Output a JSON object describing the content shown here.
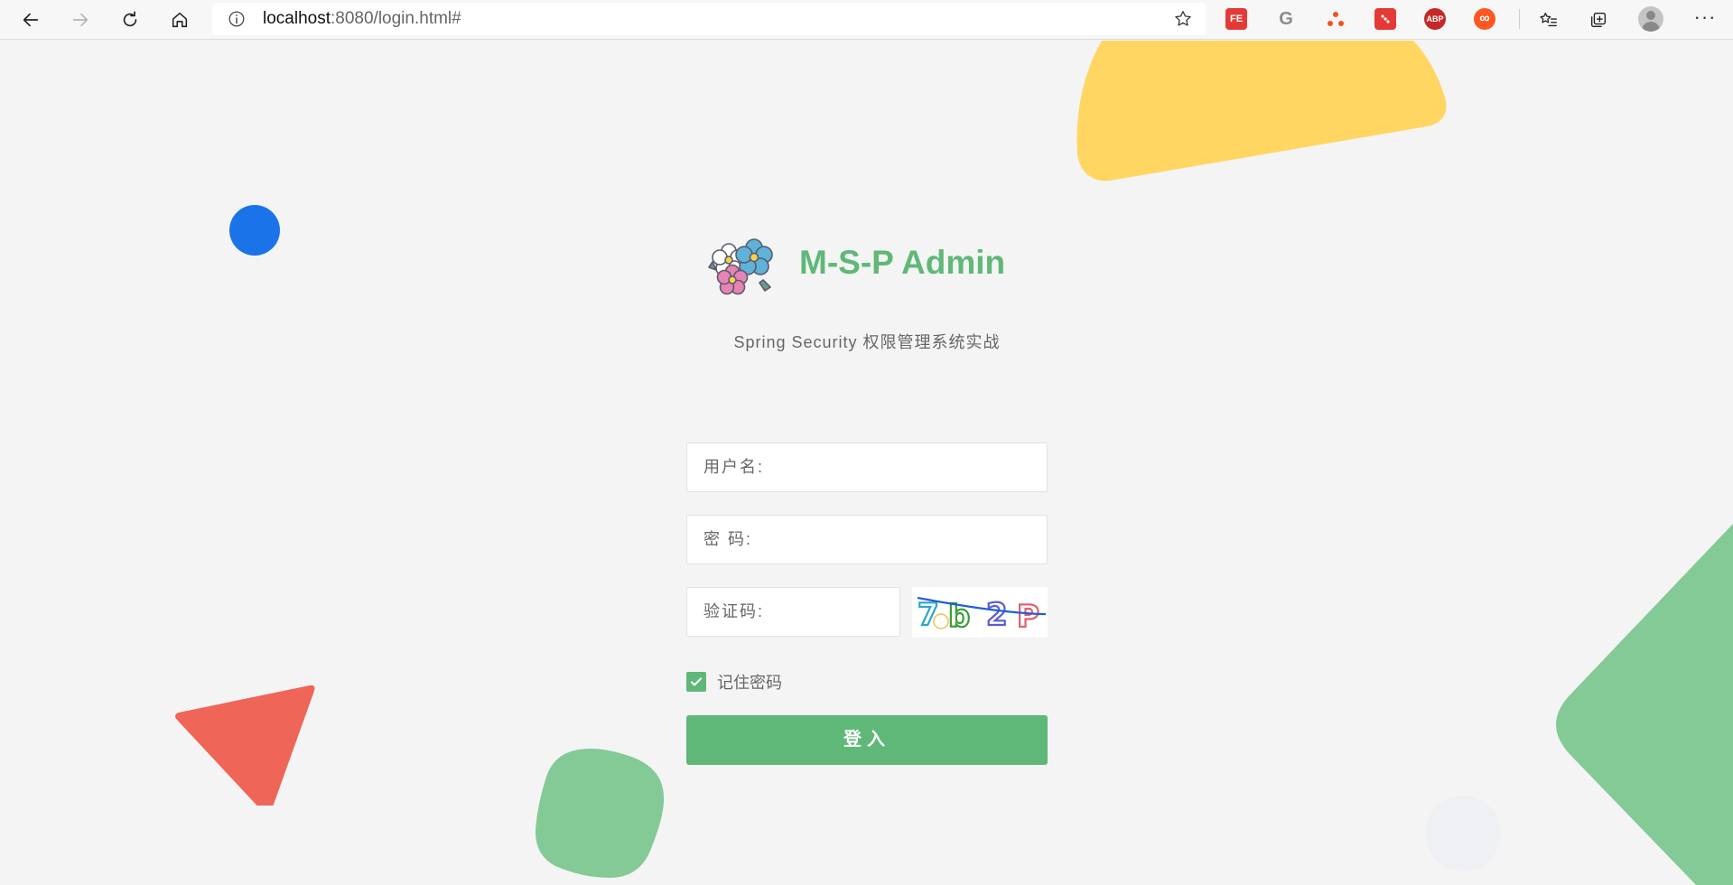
{
  "browser": {
    "address_url_host": "localhost",
    "address_url_rest": ":8080/login.html#",
    "nav": {
      "back_icon": "arrow-left-icon",
      "forward_icon": "arrow-right-icon",
      "refresh_icon": "refresh-icon",
      "home_icon": "home-icon"
    },
    "extensions": [
      {
        "name": "fe-helper-extension",
        "label": "FE",
        "color": "#d93025"
      },
      {
        "name": "grammarly-extension",
        "label": "G",
        "color": "#9e9e9e"
      },
      {
        "name": "share-extension",
        "label": "",
        "color": "#f4511e"
      },
      {
        "name": "dice-extension",
        "label": "",
        "color": "#e53935"
      },
      {
        "name": "adblock-plus-extension",
        "label": "ABP",
        "color": "#c62828"
      },
      {
        "name": "infinity-extension",
        "label": "∞",
        "color": "#ff5722"
      }
    ],
    "more_label": "···"
  },
  "login": {
    "app_title": "M-S-P Admin",
    "subtitle": "Spring Security 权限管理系统实战",
    "username_label": "用户名:",
    "password_label": "密 码:",
    "captcha_label": "验证码:",
    "captcha_text": "7b2P",
    "remember_label": "记住密码",
    "remember_checked": true,
    "submit_label": "登入"
  },
  "theme": {
    "accent": "#5fb878",
    "deco_yellow": "#ffd662",
    "deco_blue": "#1a73e8",
    "deco_red": "#ef6558",
    "deco_green": "#84ca96"
  }
}
